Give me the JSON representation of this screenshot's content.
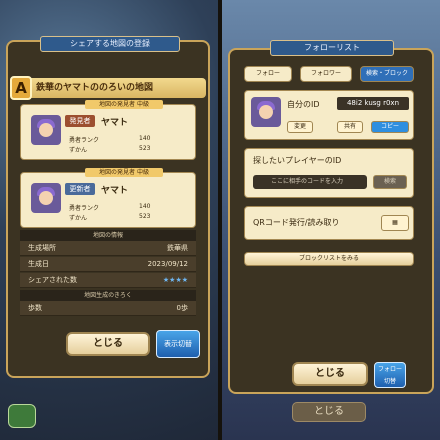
{
  "left": {
    "banner": "シェアする地図の登録",
    "header_badge": "A",
    "header_title": "鉄華のヤマトののろいの地図",
    "discoverer": {
      "tag": "地図の発見者 中級",
      "role": "発見者",
      "name": "ヤマト",
      "rank_label": "勇者ランク",
      "rank_value": "140",
      "zukan_label": "ずかん",
      "zukan_value": "523"
    },
    "updater": {
      "tag": "地図の発見者 中級",
      "role": "更新者",
      "name": "ヤマト",
      "rank_label": "勇者ランク",
      "rank_value": "140",
      "zukan_label": "ずかん",
      "zukan_value": "523"
    },
    "info_header": "地図の情報",
    "info_rows": [
      {
        "label": "生成場所",
        "value": "鉄華県"
      },
      {
        "label": "生成日",
        "value": "2023/09/12"
      },
      {
        "label": "シェアされた数",
        "value": "★★★★"
      }
    ],
    "record_header": "地図生成のきろく",
    "steps_label": "歩数",
    "steps_value": "0歩",
    "close_label": "とじる",
    "toggle_label": "表示切替"
  },
  "right": {
    "banner": "フォローリスト",
    "tabs": [
      "フォロー",
      "フォロワー",
      "検索・ブロック"
    ],
    "my_id_label": "自分のID",
    "my_id_value": "48i2 kusg r0xn",
    "small_btns": [
      "変更",
      "共有",
      "コピー"
    ],
    "search_label": "探したいプレイヤーのID",
    "search_placeholder": "ここに相手のコードを入力",
    "search_btn": "検索",
    "qr_label": "QRコード発行/読み取り",
    "block_label": "ブロックリストをみる",
    "close_label": "とじる",
    "toggle_label": "フォロー 切替",
    "bottom_close": "とじる"
  }
}
